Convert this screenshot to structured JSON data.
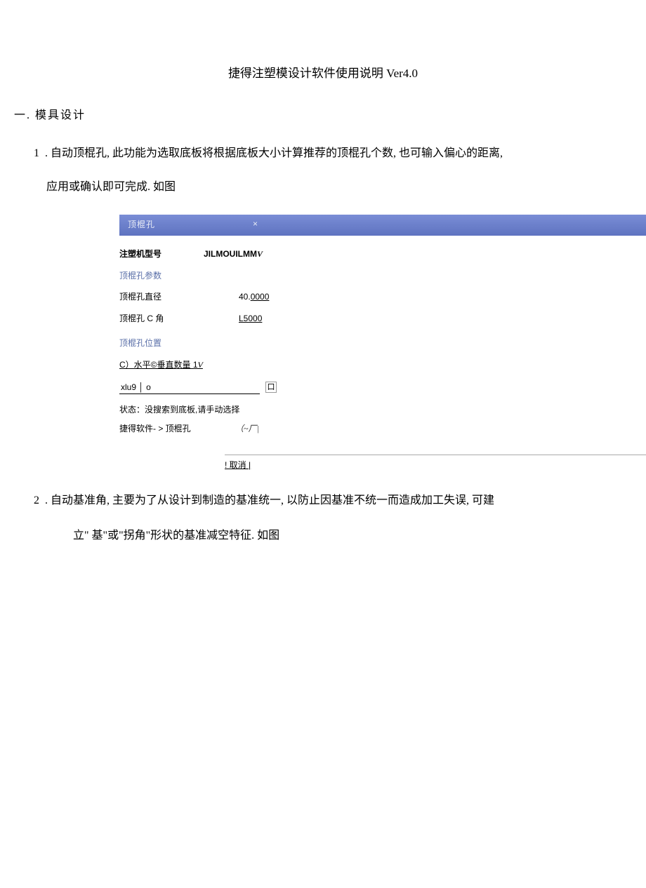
{
  "title": "捷得注塑模设计软件使用说明 Ver4.0",
  "section1": {
    "heading": "一. 模具设计",
    "item1_num": "1",
    "item1_text": ". 自动顶棍孔, 此功能为选取底板将根据底板大小计算推荐的顶棍孔个数, 也可输入偏心的距离,",
    "item1_sub": "应用或确认即可完成. 如图"
  },
  "dialog": {
    "title": "顶棍孔",
    "close_glyph": "×",
    "machine_label": "注塑机型号",
    "machine_value": "JILMOUILMM",
    "machine_suffix": "V",
    "params_label": "顶棍孔参数",
    "diameter_label": "顶棍孔直径",
    "diameter_value": "40.",
    "diameter_value_ul": "0000",
    "cangle_label": "顶棍孔 C 角",
    "cangle_value": "L5000",
    "position_label": "顶棍孔位置",
    "position_text": "C）水平©垂直数量 1",
    "position_suffix": "V",
    "input_value": "xlu9 │ o",
    "input_side": "口",
    "status_text": "状态：没搜索到底板,请手动选择",
    "path_text": "捷得软件- > 顶棍孔",
    "path_suffix": "（~厂|",
    "cancel_text": "! 取消 |"
  },
  "section2": {
    "item2_num": "2",
    "item2_text": ". 自动基准角, 主要为了从设计到制造的基准统一, 以防止因基准不统一而造成加工失误, 可建",
    "item2_sub": "立\" 基\"或\"拐角\"形状的基准减空特征. 如图"
  }
}
